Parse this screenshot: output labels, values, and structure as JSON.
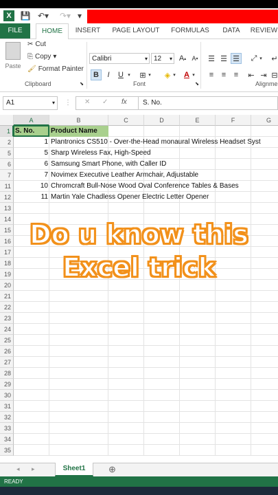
{
  "titlebar": {
    "logo": "X"
  },
  "tabs": [
    "FILE",
    "HOME",
    "INSERT",
    "PAGE LAYOUT",
    "FORMULAS",
    "DATA",
    "REVIEW"
  ],
  "clipboard": {
    "paste": "Paste",
    "cut": "Cut",
    "copy": "Copy",
    "copy_arrow": "▾",
    "format_painter": "Format Painter",
    "group_label": "Clipboard"
  },
  "font": {
    "name": "Calibri",
    "size": "12",
    "bold": "B",
    "italic": "I",
    "underline": "U",
    "group_label": "Font"
  },
  "alignment": {
    "group_label": "Alignme"
  },
  "formula_bar": {
    "name_box": "A1",
    "cancel": "✕",
    "enter": "✓",
    "fx": "fx",
    "value": "S. No."
  },
  "columns": [
    "A",
    "B",
    "C",
    "D",
    "E",
    "F",
    "G"
  ],
  "rows": [
    "1",
    "2",
    "5",
    "6",
    "7",
    "11",
    "12",
    "13",
    "14",
    "15",
    "16",
    "17",
    "18",
    "19",
    "20",
    "21",
    "22",
    "23",
    "24",
    "25",
    "26",
    "27",
    "28",
    "29",
    "30",
    "31",
    "32",
    "33",
    "34",
    "35"
  ],
  "table": {
    "headers": [
      "S. No.",
      "Product Name"
    ],
    "data": [
      [
        "1",
        "Plantronics CS510 - Over-the-Head monaural Wireless Headset Syst"
      ],
      [
        "5",
        "Sharp Wireless Fax, High-Speed"
      ],
      [
        "6",
        "Samsung Smart Phone, with Caller ID"
      ],
      [
        "7",
        "Novimex Executive Leather Armchair, Adjustable"
      ],
      [
        "10",
        "Chromcraft Bull-Nose Wood Oval Conference Tables & Bases"
      ],
      [
        "11",
        "Martin Yale Chadless Opener Electric Letter Opener"
      ]
    ]
  },
  "overlay": {
    "line1": "Do u know this",
    "line2": "Excel trick"
  },
  "sheets": {
    "active": "Sheet1",
    "add": "⊕"
  },
  "status": {
    "text": "READY"
  },
  "colors": {
    "excel_green": "#217346",
    "header_fill": "#a9d08e",
    "overlay_stroke": "#f2911b",
    "title_red": "#ff0000"
  }
}
